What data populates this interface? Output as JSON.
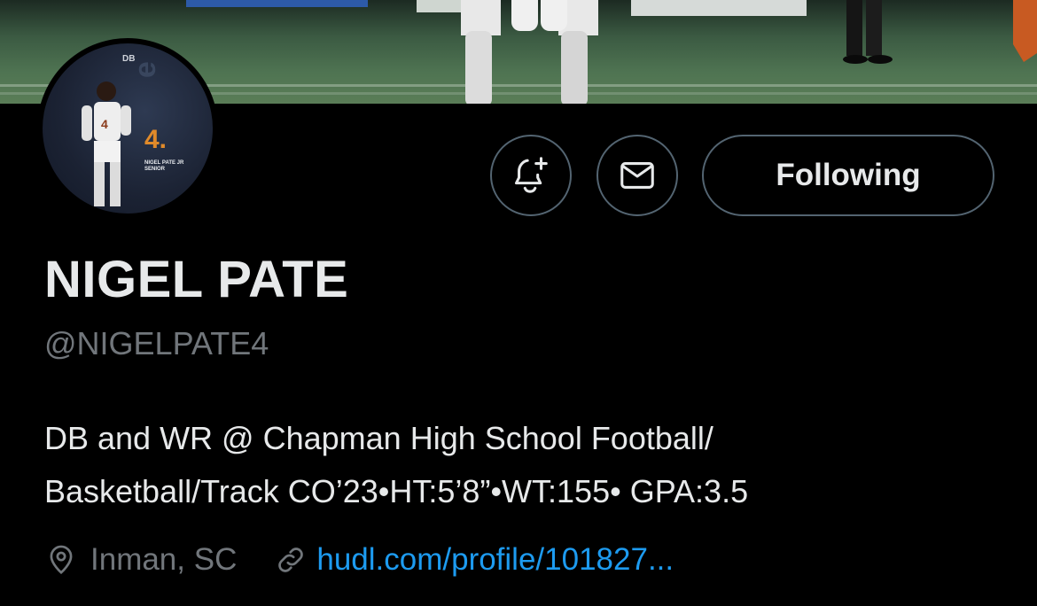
{
  "profile": {
    "name": "NIGEL PATE",
    "handle": "@NIGELPATE4",
    "bio_line1": "DB and WR @ Chapman High School Football/",
    "bio_line2": "Basketball/Track CO’23•HT:5’8”•WT:155• GPA:3.5",
    "location": "Inman, SC",
    "website": "hudl.com/profile/101827..."
  },
  "avatar": {
    "badge": "DB",
    "number": "4.",
    "caption_line1": "NIGEL PATE JR",
    "caption_line2": "SENIOR"
  },
  "actions": {
    "following_label": "Following"
  },
  "icons": {
    "notify": "bell-plus-icon",
    "message": "envelope-icon",
    "location": "map-pin-icon",
    "link": "link-icon"
  },
  "colors": {
    "background": "#000000",
    "text_primary": "#e7e9ea",
    "text_secondary": "#71767b",
    "link": "#1d9bf0",
    "border": "#536471"
  }
}
